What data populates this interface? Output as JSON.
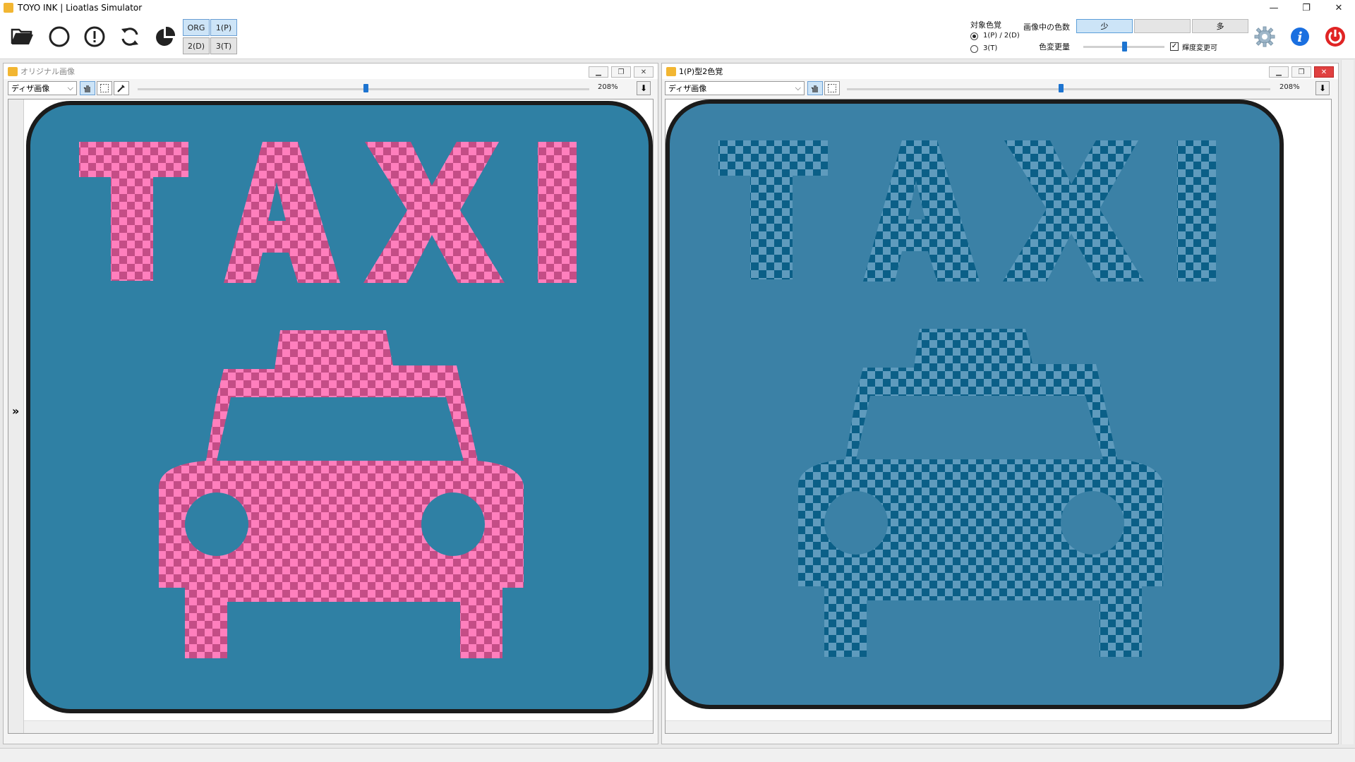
{
  "window": {
    "title": "TOYO INK | Lioatlas Simulator",
    "minimize": "—",
    "restore": "❐",
    "close": "✕"
  },
  "toolbar": {
    "icons": [
      "folder-open-icon",
      "circle-icon",
      "alert-icon",
      "refresh-icon",
      "pie-icon"
    ],
    "modes": {
      "org": "ORG",
      "p1": "1(P)",
      "d2": "2(D)",
      "t3": "3(T)"
    },
    "target_label": "対象色覚",
    "radio1_label": "1(P) / 2(D)",
    "radio2_label": "3(T)",
    "colors_in_image_label": "画像中の色数",
    "few": "少",
    "many": "多",
    "color_change_label": "色変更量",
    "luminance_label": "輝度変更可",
    "luminance_checked": "✓",
    "right_icons": [
      "settings-icon",
      "info-icon",
      "power-icon"
    ]
  },
  "left_panel": {
    "title": "オリジナル画像",
    "dropdown": "ディザ画像",
    "zoom": "208%",
    "expand": "»",
    "image": {
      "word": "TAXI",
      "bg": "#2f80a4",
      "checker_a": "#ff7fbd",
      "checker_b": "#c44d86",
      "frame": "#1b1b1b"
    }
  },
  "right_panel": {
    "title": "1(P)型2色覚",
    "dropdown": "ディザ画像",
    "zoom": "208%",
    "image": {
      "word": "TAXI",
      "bg": "#3b81a6",
      "checker_a": "#5f9bbd",
      "checker_b": "#0b5f87",
      "frame": "#1b1b1b"
    }
  },
  "colors": {
    "accent": "#1d74d0",
    "info_blue": "#1a6fe0",
    "power_red": "#e02424"
  }
}
